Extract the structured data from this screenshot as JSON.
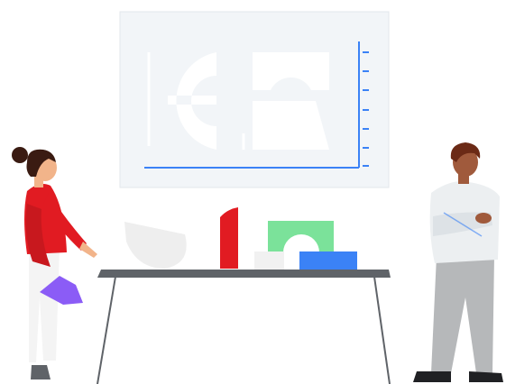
{
  "illustration": {
    "accent_blue": "#3b82f6",
    "accent_red": "#e11b22",
    "accent_green": "#7be29a",
    "accent_purple": "#8b5cf6",
    "board_bg": "#f2f5f8",
    "table_top": "#5f6368",
    "shirt_light": "#eceff1",
    "pants_grey": "#b6b8ba"
  }
}
